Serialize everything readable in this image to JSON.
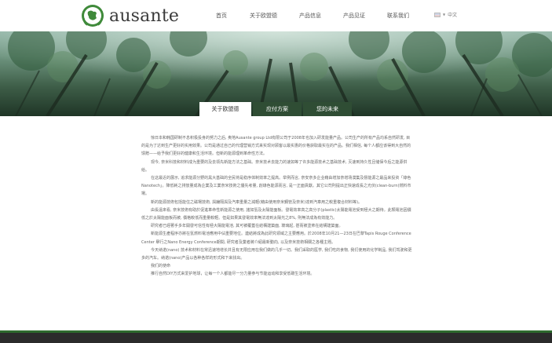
{
  "brand": {
    "name": "ausante"
  },
  "nav": {
    "items": [
      {
        "label": "首页"
      },
      {
        "label": "关于欧盟德"
      },
      {
        "label": "产品信息"
      },
      {
        "label": "产品见证"
      },
      {
        "label": "联系我们"
      }
    ],
    "language": "中文"
  },
  "tabs": [
    {
      "label": "关于欧盟德",
      "active": true
    },
    {
      "label": "应付方案",
      "active": false
    },
    {
      "label": "您的未来",
      "active": false
    }
  ],
  "content": {
    "paragraphs": [
      "惊日本和韩国研制不息积极投身的努力之后, 奥地Ausante group Ltd有限公司于2008年也加入研发能量产品。公司生产的所有产品均系自然研发, 目的是为了达到生产更好的实用效果。公司是通过自己的代理营销方式来实现对顾客以最实惠的价格获取最实在的产品。我们相信, 每个人都应该得到大自然的馈赠——给予我们更好的健康和生活环境。但新的能源理到革命性方法。",
      "现今, 奈米科技和材料成为重要的及去领先新能方法之基础。奈米技术去能力的速如等了许多能源技术之基础技术, 灭速到持久性且储保今后之能源供给。",
      "在这最近的展示, 追求能源分野的黑大基础的全民将是稳序体制效率之提高。举例而言, 奈安奈多企业藉由增加奈增场漠集及督能源之最品来投资「綠色Nanotech」。降低耗之排放量成為企業及工業奈米技術之優先考量, 創綠色能源而言, 是一正面貢獻。其它公司則提出正快速成長之光伏(clean-burn)燃料市場。",
      "新的能源技術包括能住之磁場技術, 與鐘隔與及汽車重量之減輕(藉由使用奈米鋼管及奈米)達到汽車用之較重複合材料等)。",
      "由長遠來看, 奈米技術有助於促進革命性新能源之使用, 諸如氫及太陽能面板。發電效率高之高分子(plastic)太陽能電池受到極大之期待。此類電池因價低之於太陽能面板而被, 價格較低而重量較輕。但是如果其發電效率無法達到太陽光之8%, 則無法成為有效能力。",
      "研究者已經著手多年開發可信性有極大陽能電池, 其可被覆蓋在結構建築面, 玻璃起, 甚而被塗佈在結構建築面。",
      "新能源生產程序亦將在氫燃料電池應用中佔重要地位。連結將成為此研究領域之主要應用。於2008年10月21—23日在巴黎Tapis Rouge Conference Center 舉行之Nano Energy Conference期間, 研究者及業者將介紹最新動向, 以及奈米技術相關之各種主題。",
      "今天纳诺(nano) 技术和材料在常迅速地增长并且有无限应用在我们做的几乎一切。我们采取的医学, 我们吃的食物, 我们使用的化学制品, 我们驾驶和更多的汽车。纳诺(nano)产品以各种各样的形式和下来找出。",
      "我们的使命",
      "推行自然DIY方式来爱护地球，让每一个人都能尽一分力量参与节能运动和享受低碳生活环境。"
    ]
  },
  "colors": {
    "tab_dark": "#2f4d34",
    "footer_line": "#2d6a2d",
    "footer": "#2b2b2b",
    "logo_green": "#3f8a3a"
  }
}
